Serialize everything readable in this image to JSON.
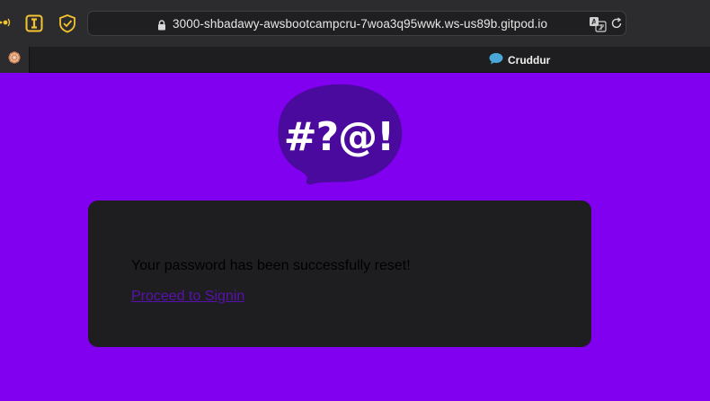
{
  "browser": {
    "url": "3000-shbadawy-awsbootcampcru-7woa3q95wwk.ws-us89b.gitpod.io",
    "extensions": [
      "dots-icon",
      "i-icon",
      "shield-check-icon"
    ],
    "tab": {
      "title": "Cruddur",
      "favicon": "speech-bubble-icon"
    },
    "pinned_tab": {
      "favicon": "flower-icon"
    }
  },
  "page": {
    "background": "#8000ef",
    "logo": {
      "glyphs": "#?@!"
    },
    "card": {
      "message": "Your password has been successfully reset!",
      "link_label": "Proceed to Signin"
    }
  },
  "colors": {
    "accent": "#8000ef",
    "logo_bubble": "#4b0a9e",
    "card_bg": "#1e1e20",
    "link": "#5a10b0"
  }
}
